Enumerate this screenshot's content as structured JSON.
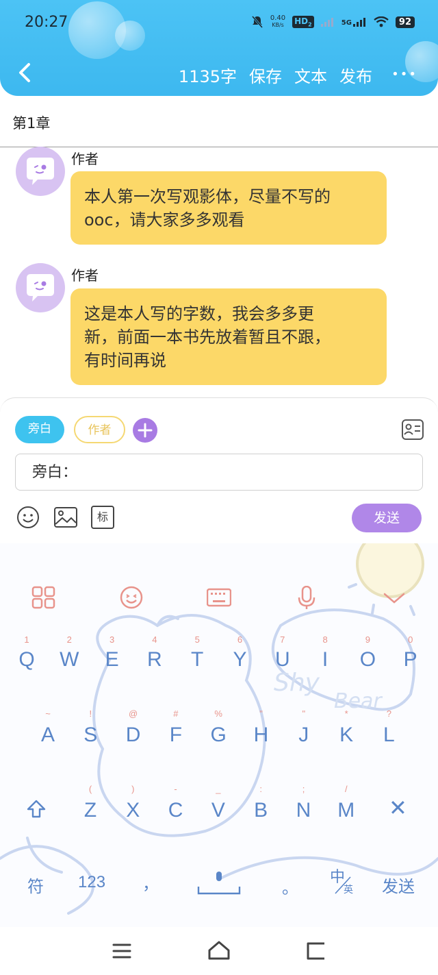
{
  "status_bar": {
    "time": "20:27",
    "net_speed_value": "0.40",
    "net_speed_unit": "KB/s",
    "hd_label": "HD",
    "hd_sub": "2",
    "signal_label": "5G",
    "battery": "92"
  },
  "header": {
    "word_count": "1135字",
    "save_label": "保存",
    "text_label": "文本",
    "publish_label": "发布",
    "more_label": "•••"
  },
  "chapter_title": "第1章",
  "messages": [
    {
      "author": "作者",
      "text_line1": "本人第一次写观影体，尽量不写的",
      "text_line2": "ooc，请大家多多观看",
      "text_line3": ""
    },
    {
      "author": "作者",
      "text_line1": "这是本人写的字数，我会多多更",
      "text_line2": "新，前面一本书先放着暂且不跟，",
      "text_line3": "有时间再说"
    }
  ],
  "composer": {
    "role_narration": "旁白",
    "role_author": "作者",
    "input_value": "旁白：",
    "send_label": "发送",
    "tag_label": "标"
  },
  "keyboard": {
    "row1": [
      "Q",
      "W",
      "E",
      "R",
      "T",
      "Y",
      "U",
      "I",
      "O",
      "P"
    ],
    "row1_hints": [
      "1",
      "2",
      "3",
      "4",
      "5",
      "6",
      "7",
      "8",
      "9",
      "0"
    ],
    "row2": [
      "A",
      "S",
      "D",
      "F",
      "G",
      "H",
      "J",
      "K",
      "L"
    ],
    "row2_hints": [
      "~",
      "!",
      "@",
      "#",
      "%",
      "\"",
      "\"",
      "*",
      "?"
    ],
    "row3": [
      "Z",
      "X",
      "C",
      "V",
      "B",
      "N",
      "M"
    ],
    "row3_hints": [
      "(",
      ")",
      "-",
      "_",
      ":",
      ";",
      "/"
    ],
    "symbol_label": "符",
    "num_label": "123",
    "comma_label": "，",
    "period_label": "。",
    "lang_main": "中",
    "lang_sub": "英",
    "send_label": "发送",
    "delete_label": "✕",
    "doodle_text_1": "Shy",
    "doodle_text_2": "Bear"
  },
  "colors": {
    "header_blue": "#3db8ef",
    "bubble_yellow": "#fcd868",
    "avatar_purple": "#d8c3f2",
    "accent_purple": "#b087e8",
    "key_blue": "#5a86c8",
    "hint_red": "#e8938b"
  }
}
